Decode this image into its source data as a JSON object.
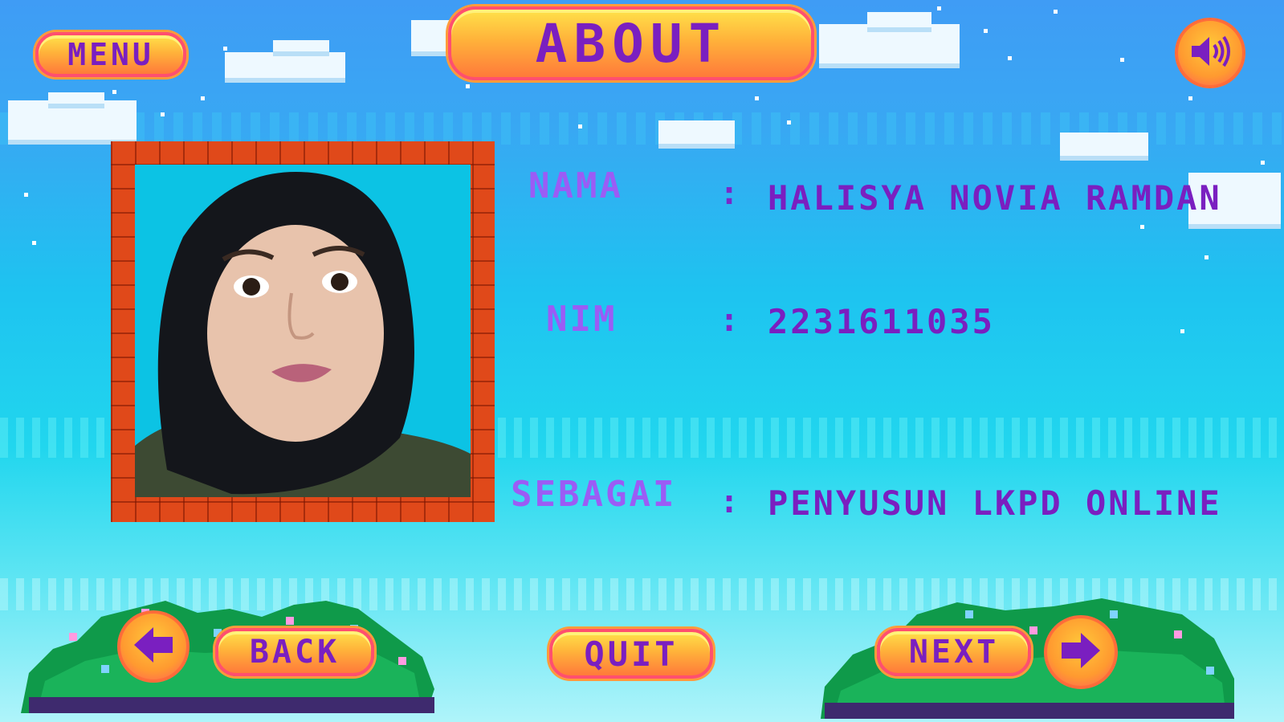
{
  "header": {
    "title": "ABOUT"
  },
  "buttons": {
    "menu": "MENU",
    "back": "BACK",
    "quit": "QUIT",
    "next": "NEXT"
  },
  "profile": {
    "rows": [
      {
        "label": "NAMA",
        "colon": ":",
        "value": "HALISYA NOVIA RAMDAN"
      },
      {
        "label": "NIM",
        "colon": ":",
        "value": "2231611035"
      },
      {
        "label": "SEBAGAI",
        "colon": ":",
        "value": "PENYUSUN LKPD ONLINE"
      }
    ]
  },
  "icons": {
    "sound": "speaker-volume-icon",
    "back_arrow": "arrow-left-icon",
    "next_arrow": "arrow-right-icon"
  },
  "colors": {
    "accent_purple": "#7a1fc0",
    "label_purple": "#9b5cf5",
    "frame_brick": "#e0491a",
    "button_orange": "#ffb23a"
  }
}
